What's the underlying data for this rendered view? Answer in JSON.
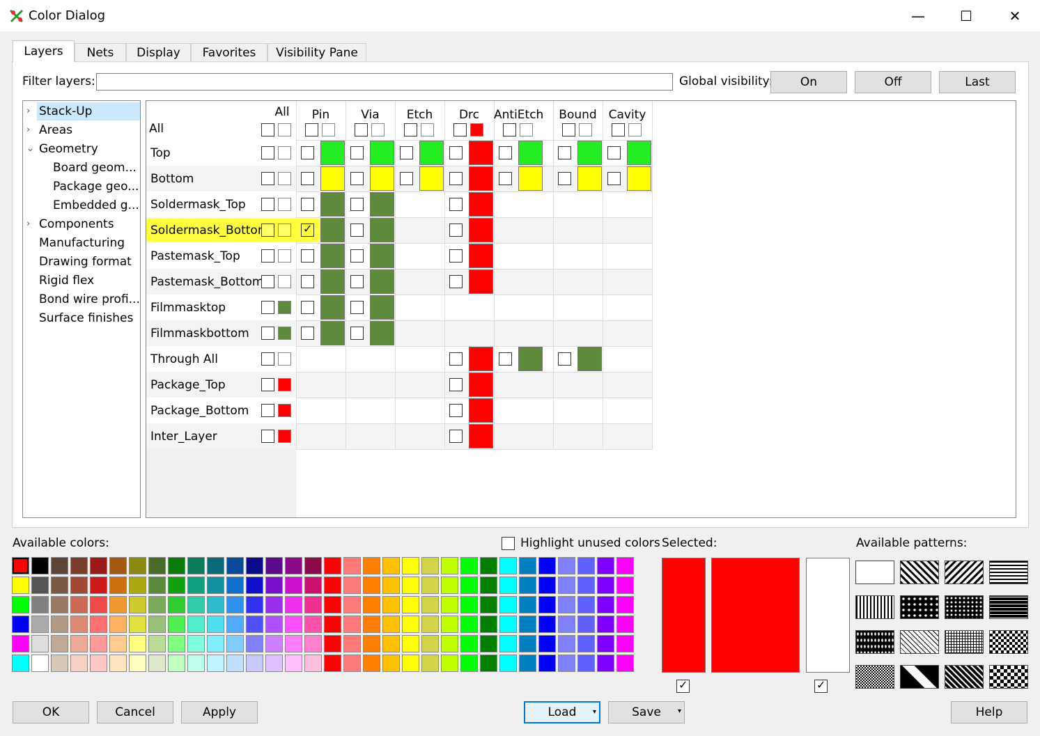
{
  "window": {
    "title": "Color Dialog",
    "minimize": "—",
    "maximize": "☐",
    "close": "✕"
  },
  "tabs": [
    "Layers",
    "Nets",
    "Display",
    "Favorites",
    "Visibility Pane"
  ],
  "filter": {
    "label": "Filter layers:",
    "value": ""
  },
  "global": {
    "label": "Global visibility:",
    "on": "On",
    "off": "Off",
    "last": "Last"
  },
  "tree": [
    {
      "label": "Stack-Up",
      "arrow": "›",
      "selected": true
    },
    {
      "label": "Areas",
      "arrow": "›"
    },
    {
      "label": "Geometry",
      "arrow": "⌄"
    },
    {
      "label": "Board geom...",
      "arrow": ""
    },
    {
      "label": "Package geo...",
      "arrow": ""
    },
    {
      "label": "Embedded g...",
      "arrow": ""
    },
    {
      "label": "Components",
      "arrow": "›"
    },
    {
      "label": "Manufacturing",
      "arrow": ""
    },
    {
      "label": "Drawing format",
      "arrow": ""
    },
    {
      "label": "Rigid flex",
      "arrow": ""
    },
    {
      "label": "Bond wire profi...",
      "arrow": ""
    },
    {
      "label": "Surface finishes",
      "arrow": ""
    }
  ],
  "grid": {
    "all_label": "All",
    "columns": [
      "Pin",
      "Via",
      "Etch",
      "Drc",
      "AntiEtch",
      "Bound",
      "Cavity"
    ],
    "header_colors": {
      "Drc": "#ff0000"
    },
    "rows": [
      {
        "name": "Top",
        "all_color": "",
        "cells": {
          "Pin": "#22ee22",
          "Via": "#22ee22",
          "Etch": "#22ee22",
          "Drc": "#ff0000",
          "AntiEtch": "#22ee22",
          "Bound": "#22ee22",
          "Cavity": "#22ee22"
        }
      },
      {
        "name": "Bottom",
        "all_color": "",
        "cells": {
          "Pin": "#ffff00",
          "Via": "#ffff00",
          "Etch": "#ffff00",
          "Drc": "#ff0000",
          "AntiEtch": "#ffff00",
          "Bound": "#ffff00",
          "Cavity": "#ffff00"
        }
      },
      {
        "name": "Soldermask_Top",
        "all_color": "",
        "cells": {
          "Pin": "#5f8a3c",
          "Via": "#5f8a3c",
          "Drc": "#ff0000"
        }
      },
      {
        "name": "Soldermask_Bottom",
        "all_color": "#ffff66",
        "highlight": true,
        "pin_checked": true,
        "cells": {
          "Pin": "#5f8a3c",
          "Via": "#5f8a3c",
          "Drc": "#ff0000"
        }
      },
      {
        "name": "Pastemask_Top",
        "all_color": "",
        "cells": {
          "Pin": "#5f8a3c",
          "Via": "#5f8a3c",
          "Drc": "#ff0000"
        }
      },
      {
        "name": "Pastemask_Bottom",
        "all_color": "",
        "cells": {
          "Pin": "#5f8a3c",
          "Via": "#5f8a3c",
          "Drc": "#ff0000"
        }
      },
      {
        "name": "Filmmasktop",
        "all_color": "#5f8a3c",
        "cells": {
          "Pin": "#5f8a3c",
          "Via": "#5f8a3c"
        }
      },
      {
        "name": "Filmmaskbottom",
        "all_color": "#5f8a3c",
        "cells": {
          "Pin": "#5f8a3c",
          "Via": "#5f8a3c"
        }
      },
      {
        "name": "Through All",
        "all_color": "",
        "cells": {
          "Drc": "#ff0000",
          "AntiEtch": "#5f8a3c",
          "Bound": "#5f8a3c"
        }
      },
      {
        "name": "Package_Top",
        "all_color": "#ff0000",
        "cells": {
          "Drc": "#ff0000"
        }
      },
      {
        "name": "Package_Bottom",
        "all_color": "#ff0000",
        "cells": {
          "Drc": "#ff0000"
        }
      },
      {
        "name": "Inter_Layer",
        "all_color": "#ff0000",
        "cells": {
          "Drc": "#ff0000"
        }
      }
    ]
  },
  "colors": {
    "label": "Available colors:",
    "highlight_label": "Highlight unused colors",
    "rows": [
      [
        "#ff0000",
        "#000000",
        "#5c4536",
        "#7a3d2c",
        "#9a1a1a",
        "#a35a10",
        "#8a8a10",
        "#4a6a2a",
        "#0a7a0a",
        "#0a7a5a",
        "#0a6a7a",
        "#0a4a9a",
        "#0a0a8a",
        "#5a0a8a",
        "#8a0a8a",
        "#8a0a4a",
        "#ff0000",
        "#ff7a7a",
        "#ff8000",
        "#ffc000",
        "#ffff00",
        "#d4d44a",
        "#c0ff00",
        "#00ff00",
        "#008000",
        "#00ffff",
        "#0080c0",
        "#0000ff",
        "#8080ff",
        "#6060ff",
        "#8000ff",
        "#ff00ff"
      ],
      [
        "#ffff00",
        "#555555",
        "#7a5a46",
        "#a04a35",
        "#cc1a1a",
        "#cc7010",
        "#aaaa10",
        "#5a8a3a",
        "#10a010",
        "#10a080",
        "#1090a0",
        "#1070cc",
        "#1010cc",
        "#7a10cc",
        "#cc10cc",
        "#cc1070",
        "#ff0000",
        "#ff7a7a",
        "#ff8000",
        "#ffc000",
        "#ffff00",
        "#d4d44a",
        "#c0ff00",
        "#00ff00",
        "#008000",
        "#00ffff",
        "#0080c0",
        "#0000ff",
        "#8080ff",
        "#6060ff",
        "#8000ff",
        "#ff00ff"
      ],
      [
        "#00ff00",
        "#808080",
        "#9a7a66",
        "#cc6a55",
        "#ee4a4a",
        "#ee9a30",
        "#cccc30",
        "#7aaa5a",
        "#30cc30",
        "#30ccaa",
        "#30bbcc",
        "#3090ee",
        "#3030ee",
        "#9a30ee",
        "#ee30ee",
        "#ee3090",
        "#ff0000",
        "#ff7a7a",
        "#ff8000",
        "#ffc000",
        "#ffff00",
        "#d4d44a",
        "#c0ff00",
        "#00ff00",
        "#008000",
        "#00ffff",
        "#0080c0",
        "#0000ff",
        "#8080ff",
        "#6060ff",
        "#8000ff",
        "#ff00ff"
      ],
      [
        "#0000ff",
        "#aaaaaa",
        "#b09a86",
        "#dd8a75",
        "#ff7070",
        "#ffb060",
        "#e0e040",
        "#99c07a",
        "#50ee50",
        "#50eecc",
        "#50ddee",
        "#50aaff",
        "#5050ff",
        "#b050ff",
        "#ff50ff",
        "#ff50aa",
        "#ff0000",
        "#ff7a7a",
        "#ff8000",
        "#ffc000",
        "#ffff00",
        "#d4d44a",
        "#c0ff00",
        "#00ff00",
        "#008000",
        "#00ffff",
        "#0080c0",
        "#0000ff",
        "#8080ff",
        "#6060ff",
        "#8000ff",
        "#ff00ff"
      ],
      [
        "#ff00ff",
        "#dddddd",
        "#c0aa96",
        "#eeaa99",
        "#ff9a9a",
        "#ffcc90",
        "#ffff80",
        "#bbdd99",
        "#80ff80",
        "#80ffdd",
        "#80eeff",
        "#80ccff",
        "#8080ff",
        "#cc80ff",
        "#ff80ff",
        "#ff80cc",
        "#ff0000",
        "#ff7a7a",
        "#ff8000",
        "#ffc000",
        "#ffff00",
        "#d4d44a",
        "#c0ff00",
        "#00ff00",
        "#008000",
        "#00ffff",
        "#0080c0",
        "#0000ff",
        "#8080ff",
        "#6060ff",
        "#8000ff",
        "#ff00ff"
      ],
      [
        "#00ffff",
        "#ffffff",
        "#d8c8b8",
        "#f8d0c4",
        "#ffc8c8",
        "#ffe4c0",
        "#ffffc0",
        "#dde8cc",
        "#c0ffc0",
        "#c0ffee",
        "#c0f4ff",
        "#c0e0ff",
        "#c8c8ff",
        "#e0c0ff",
        "#ffc0ff",
        "#ffc0e0",
        "#ff0000",
        "#ff7a7a",
        "#ff8000",
        "#ffc000",
        "#ffff00",
        "#d4d44a",
        "#c0ff00",
        "#00ff00",
        "#008000",
        "#00ffff",
        "#0080c0",
        "#0000ff",
        "#8080ff",
        "#6060ff",
        "#8000ff",
        "#ff00ff"
      ]
    ]
  },
  "selected": {
    "label": "Selected:",
    "color1": "#ff0000",
    "color2": "#ff0000",
    "color3": "#ffffff"
  },
  "patterns": {
    "label": "Available patterns:"
  },
  "footer": {
    "ok": "OK",
    "cancel": "Cancel",
    "apply": "Apply",
    "load": "Load",
    "save": "Save",
    "help": "Help",
    "dropdown_arrow": "▾"
  }
}
